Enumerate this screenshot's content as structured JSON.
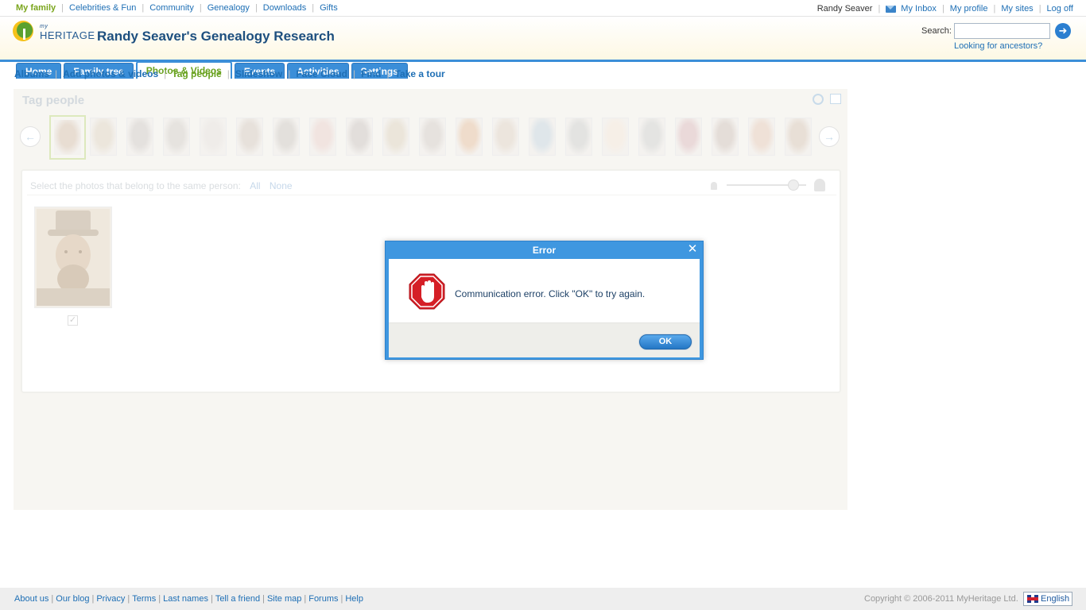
{
  "top_nav": {
    "items": [
      "My family",
      "Celebrities & Fun",
      "Community",
      "Genealogy",
      "Downloads",
      "Gifts"
    ],
    "active": "My family"
  },
  "user_nav": {
    "username": "Randy Seaver",
    "inbox": "My Inbox",
    "profile": "My profile",
    "sites": "My sites",
    "logoff": "Log off"
  },
  "header": {
    "logo_small": "my",
    "logo_text": "HERITAGE",
    "site_title": "Randy Seaver's Genealogy Research",
    "search_label": "Search:",
    "search_value": "",
    "ancestors_link": "Looking for ancestors?"
  },
  "tabs": {
    "items": [
      "Home",
      "Family tree",
      "Photos & Videos",
      "Events",
      "Activities",
      "Settings"
    ],
    "active": "Photos & Videos"
  },
  "subnav": {
    "items": [
      "Albums",
      "Add photos & videos",
      "Tag people",
      "Slideshow",
      "Face Cloud",
      "Find",
      "Take a tour"
    ],
    "active": "Tag people"
  },
  "tag_panel": {
    "title": "Tag people",
    "select_prompt": "Select the photos that belong to the same person:",
    "all_link": "All",
    "none_link": "None",
    "photo_checked": true,
    "face_count": 21
  },
  "dialog": {
    "title": "Error",
    "message": "Communication error. Click \"OK\" to try again.",
    "ok_label": "OK"
  },
  "footer": {
    "links": [
      "About us",
      "Our blog",
      "Privacy",
      "Terms",
      "Last names",
      "Tell a friend",
      "Site map",
      "Forums",
      "Help"
    ],
    "copyright": "Copyright © 2006-2011 MyHeritage Ltd.",
    "language": "English"
  },
  "colors": {
    "brand_blue": "#3b8ed8",
    "active_green": "#6aa220",
    "link_blue": "#1e6fb5",
    "dialog_blue": "#3f97e0",
    "stop_red": "#d51f26"
  }
}
